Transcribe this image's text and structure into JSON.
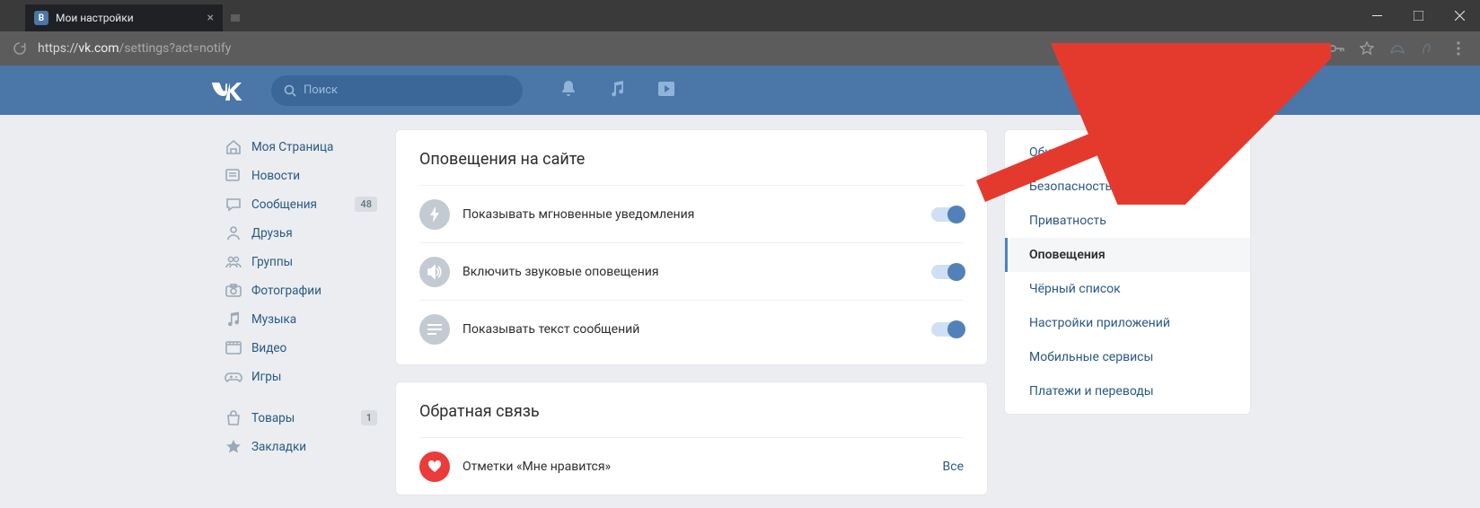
{
  "browser": {
    "tab_title": "Мои настройки",
    "url_proto": "https://",
    "url_host": "vk.com",
    "url_path": "/settings?act=notify"
  },
  "header": {
    "search_placeholder": "Поиск"
  },
  "nav": {
    "items": [
      {
        "label": "Моя Страница",
        "icon": "home"
      },
      {
        "label": "Новости",
        "icon": "news"
      },
      {
        "label": "Сообщения",
        "icon": "msg",
        "badge": "48"
      },
      {
        "label": "Друзья",
        "icon": "friend"
      },
      {
        "label": "Группы",
        "icon": "group"
      },
      {
        "label": "Фотографии",
        "icon": "photo"
      },
      {
        "label": "Музыка",
        "icon": "music"
      },
      {
        "label": "Видео",
        "icon": "video"
      },
      {
        "label": "Игры",
        "icon": "game"
      }
    ],
    "items2": [
      {
        "label": "Товары",
        "icon": "bag",
        "badge": "1"
      },
      {
        "label": "Закладки",
        "icon": "star"
      }
    ]
  },
  "sections": {
    "site_notifications": {
      "title": "Оповещения на сайте",
      "rows": [
        {
          "label": "Показывать мгновенные уведомления"
        },
        {
          "label": "Включить звуковые оповещения"
        },
        {
          "label": "Показывать текст сообщений"
        }
      ]
    },
    "feedback": {
      "title": "Обратная связь",
      "row_label": "Отметки «Мне нравится»",
      "row_action": "Все"
    }
  },
  "settings_menu": {
    "items": [
      {
        "label": "Общее"
      },
      {
        "label": "Безопасность"
      },
      {
        "label": "Приватность"
      },
      {
        "label": "Оповещения",
        "active": true
      },
      {
        "label": "Чёрный список"
      },
      {
        "label": "Настройки приложений"
      },
      {
        "label": "Мобильные сервисы"
      },
      {
        "label": "Платежи и переводы"
      }
    ]
  }
}
